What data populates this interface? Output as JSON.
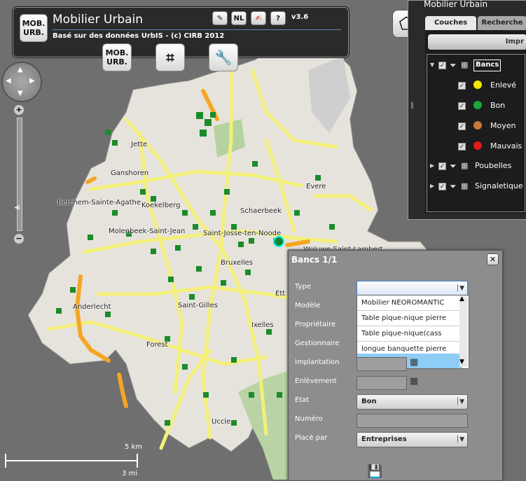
{
  "header": {
    "title": "Mobilier Urbain",
    "subtitle": "Basé sur des données UrbIS - (c) CIRB 2012",
    "version": "v3.6",
    "lang_button": "NL",
    "help_button": "?",
    "logo_line1": "MOB.",
    "logo_line2": "URB.",
    "tool_logo_line1": "MOB.",
    "tool_logo_line2": "URB."
  },
  "map": {
    "places": [
      "Jette",
      "Ganshoren",
      "Berchem-Sainte-Agathe",
      "Koekelberg",
      "Molenbeek-Saint-Jean",
      "Saint-Josse-ten-Noode",
      "Schaerbeek",
      "Evere",
      "Bruxelles",
      "Anderlecht",
      "Saint-Gilles",
      "Ixelles",
      "Forest",
      "Uccle",
      "Ett",
      "Woluwe-Saint-Lambert"
    ],
    "scale_km": "5 km",
    "scale_mi": "3 mi",
    "zoom_in": "+",
    "zoom_out": "−"
  },
  "layers_panel": {
    "title": "Mobilier Urbain",
    "tabs": [
      "Couches",
      "Recherche"
    ],
    "print_label": "Impr",
    "layers": [
      {
        "label": "Bancs",
        "expanded": true
      },
      {
        "label": "Poubelles",
        "expanded": false
      },
      {
        "label": "Signaletique",
        "expanded": false
      }
    ],
    "bench_states": [
      {
        "label": "Enlevé",
        "color": "#f5e600"
      },
      {
        "label": "Bon",
        "color": "#1aa640"
      },
      {
        "label": "Moyen",
        "color": "#c8783c"
      },
      {
        "label": "Mauvais",
        "color": "#e01c1c"
      }
    ]
  },
  "popup": {
    "title": "Bancs 1/1",
    "fields": [
      "Type",
      "Modèle",
      "Propriétaire",
      "Gestionnaire",
      "Implantation",
      "Enlèvement",
      "Etat",
      "Numéro",
      "Placé par"
    ],
    "type_value": "",
    "dropdown_options": [
      "Mobilier NEOROMANTIC",
      "Table pique-nique pierre",
      "Table pique-nique(cass",
      "longue banquette pierre",
      ""
    ],
    "etat_value": "Bon",
    "numero_value": "",
    "place_par_value": "Entreprises"
  }
}
